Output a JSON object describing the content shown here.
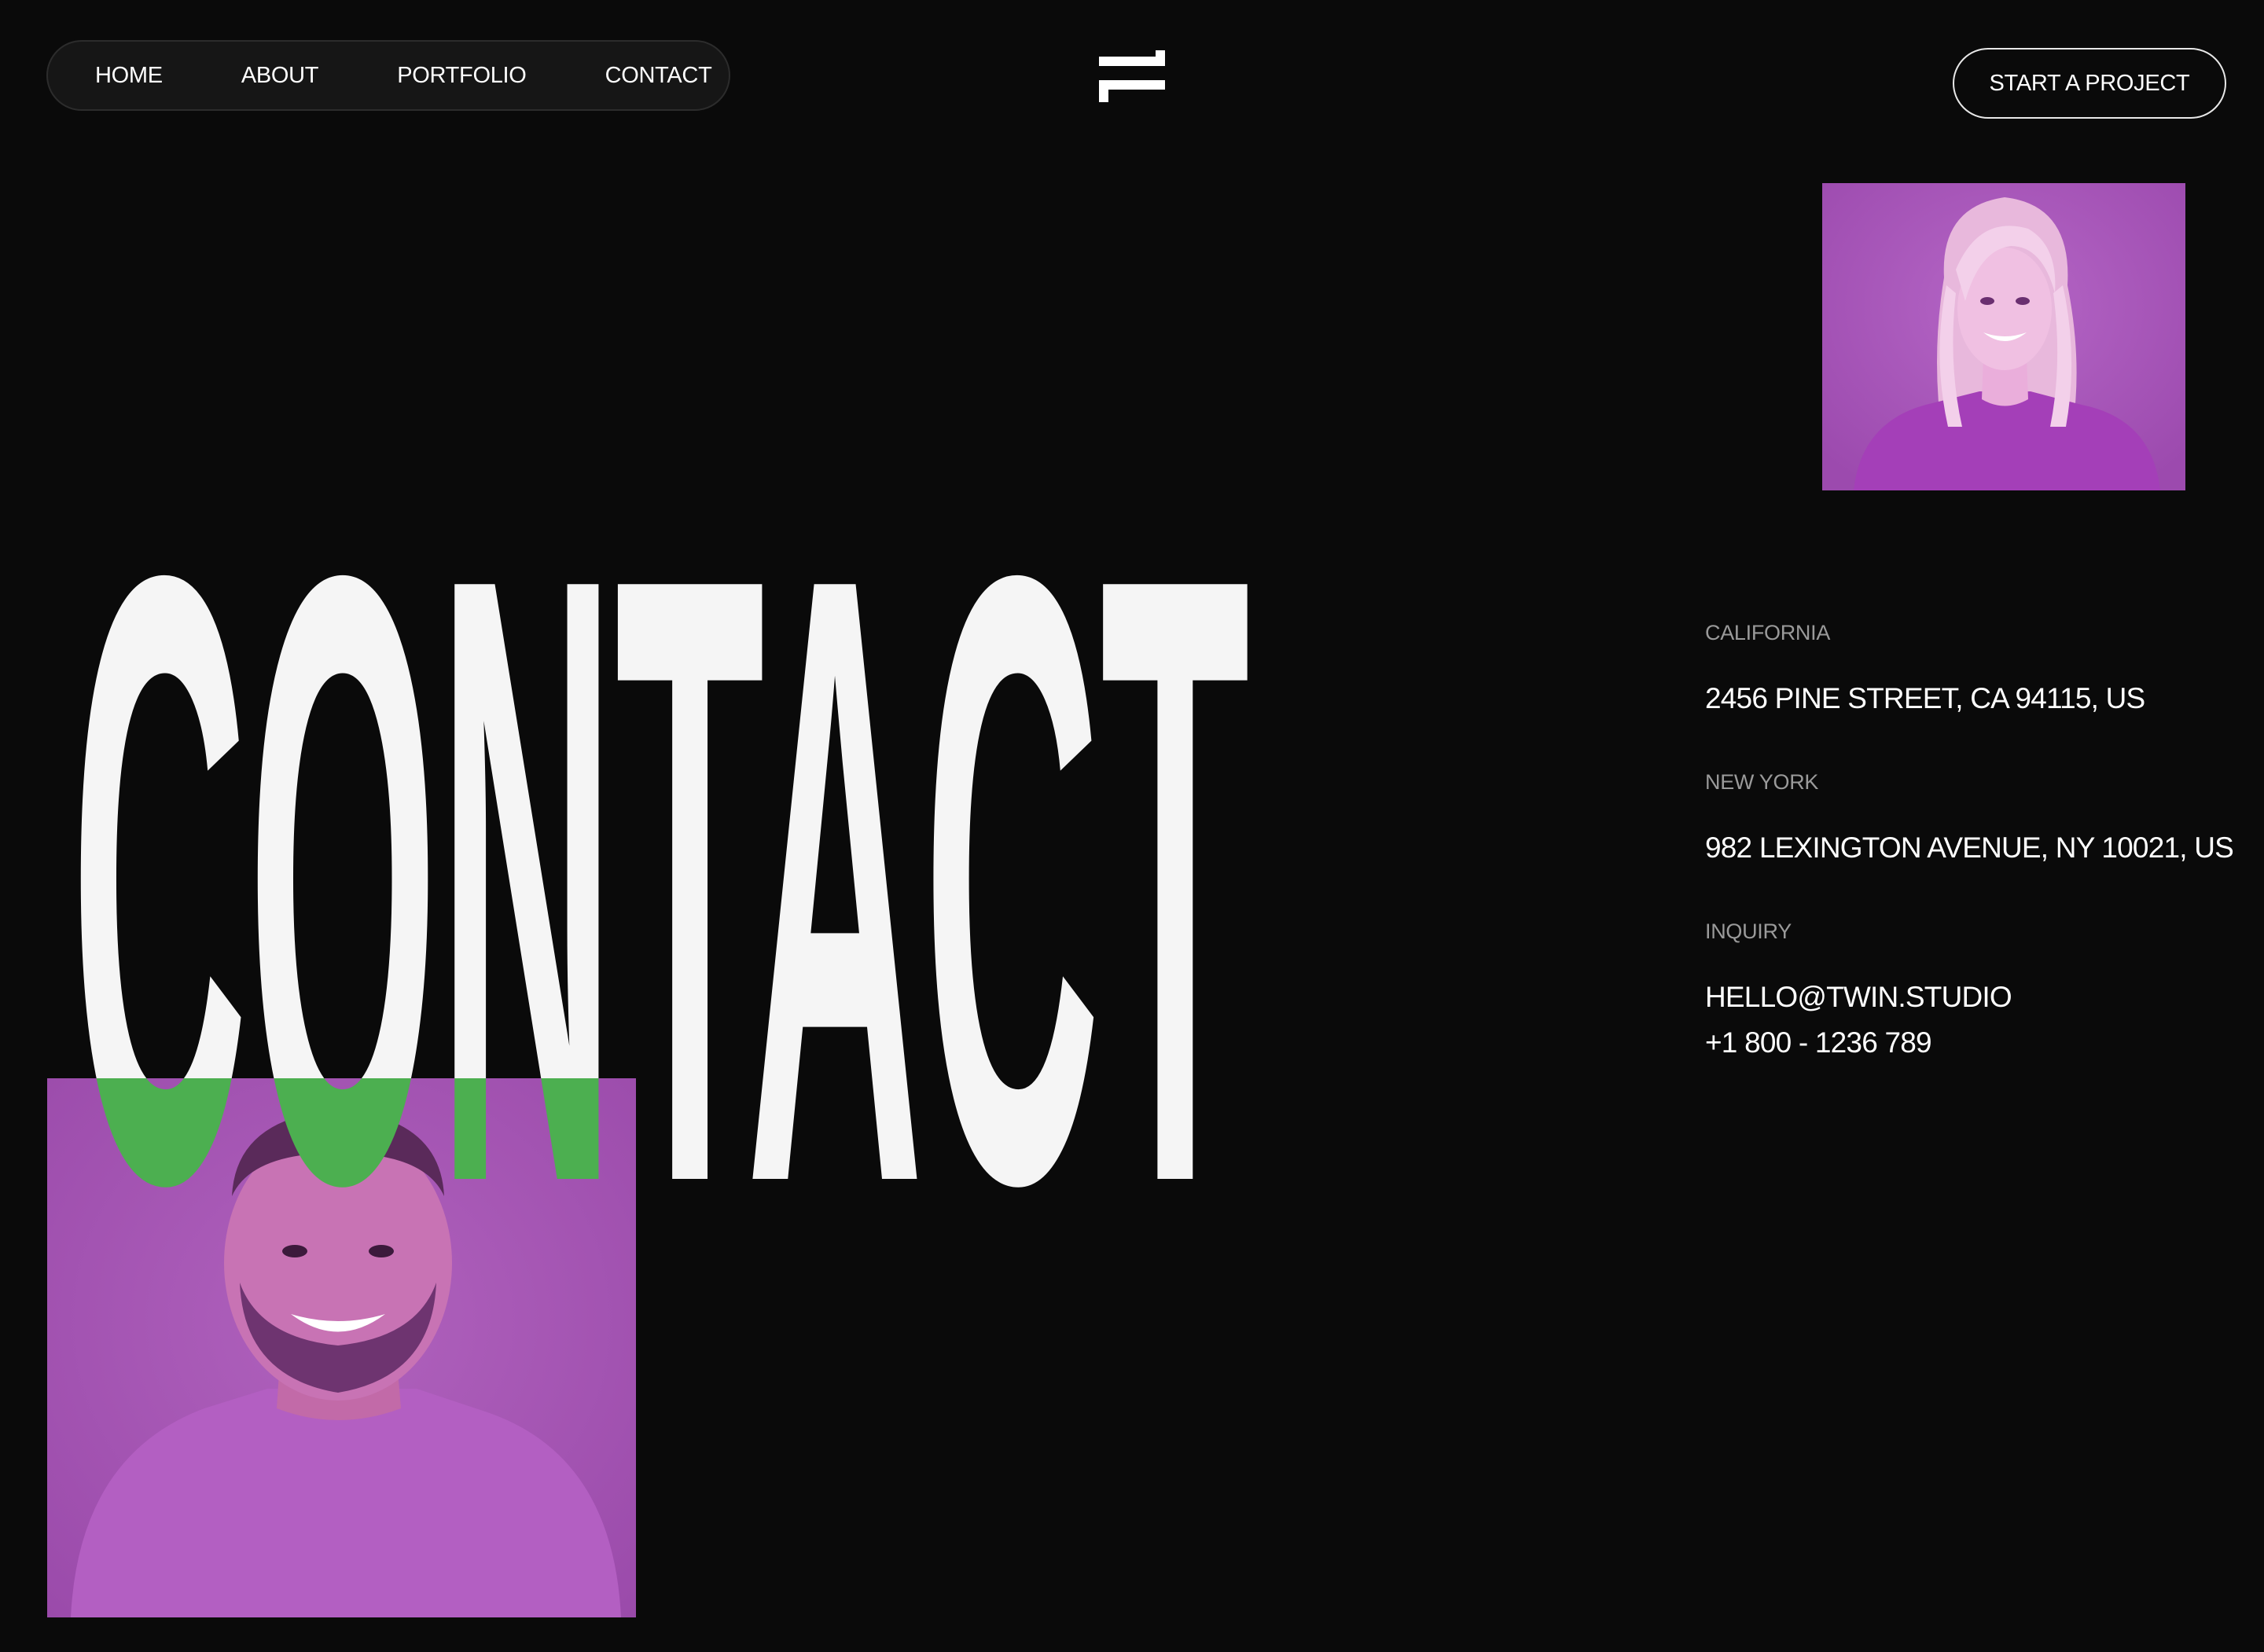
{
  "nav": {
    "items": [
      {
        "label": "HOME"
      },
      {
        "label": "ABOUT"
      },
      {
        "label": "PORTFOLIO"
      },
      {
        "label": "CONTACT"
      }
    ]
  },
  "logo": {
    "icon": "twin-logo-icon"
  },
  "cta": {
    "label": "START A PROJECT"
  },
  "hero": {
    "title": "CONTACT"
  },
  "locations": [
    {
      "label": "CALIFORNIA",
      "address": "2456 PINE STREET, CA 94115, US"
    },
    {
      "label": "NEW YORK",
      "address": "982 LEXINGTON AVENUE, NY 10021, US"
    }
  ],
  "inquiry": {
    "label": "INQUIRY",
    "email": "HELLO@TWIN.STUDIO",
    "phone": "+1 800 - 1236 789"
  },
  "colors": {
    "background": "#0a0a0a",
    "headline": "#f5f5f5",
    "accent_green": "#4caf50",
    "photo_tint": "#a552b8",
    "muted_label": "#9a9a9a"
  }
}
